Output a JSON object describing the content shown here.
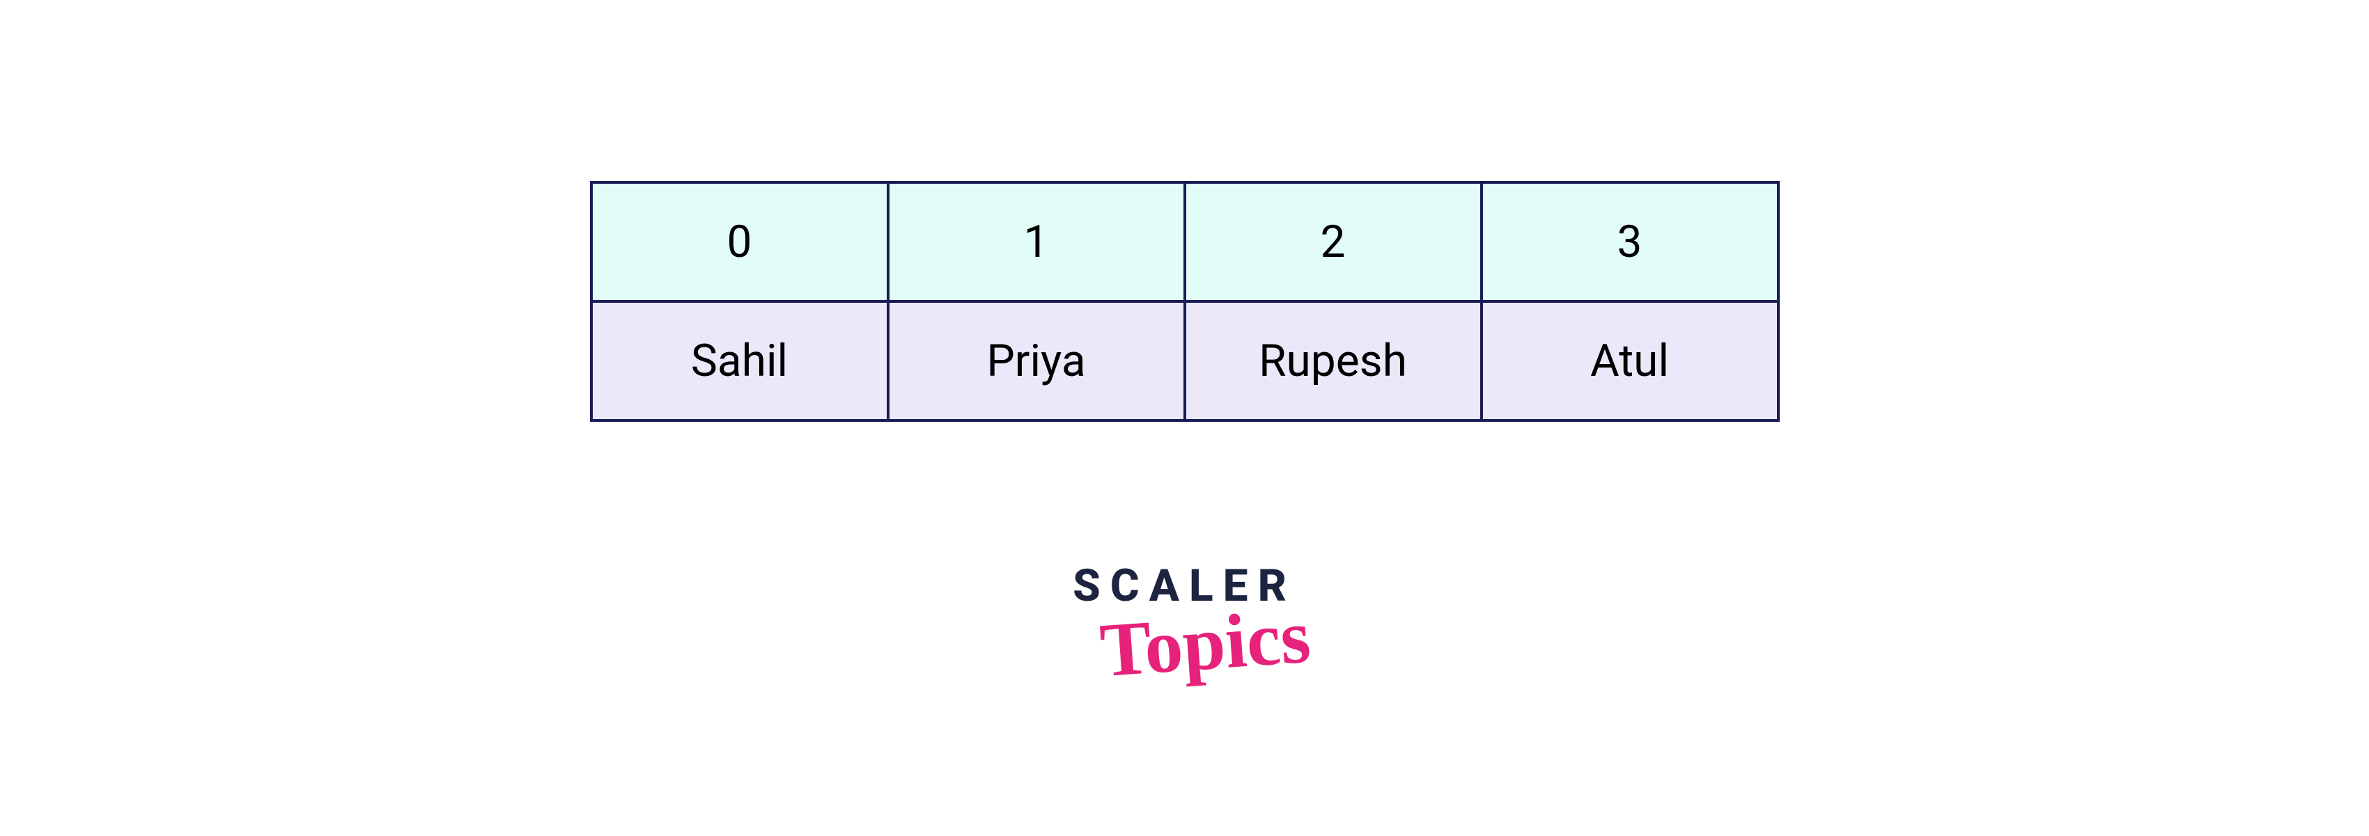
{
  "array": {
    "indices": [
      "0",
      "1",
      "2",
      "3"
    ],
    "values": [
      "Sahil",
      "Priya",
      "Rupesh",
      "Atul"
    ]
  },
  "logo": {
    "line1": "SCALER",
    "line2": "Topics"
  },
  "colors": {
    "border": "#1a1c55",
    "index_bg": "#e2fcf8",
    "value_bg": "#ece8fa",
    "logo_dark": "#1c2440",
    "logo_pink": "#e6227a"
  }
}
